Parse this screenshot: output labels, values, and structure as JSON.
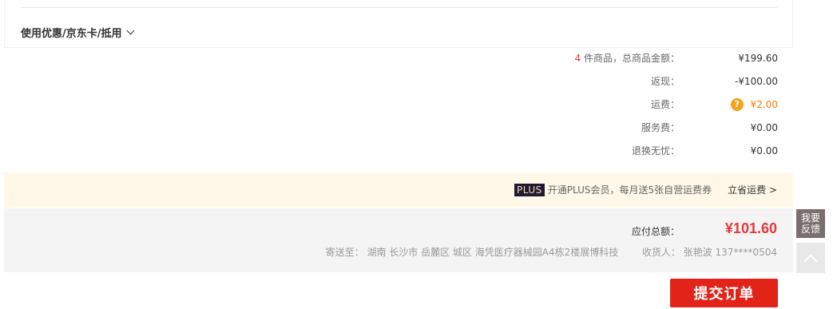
{
  "coupon": {
    "label": "使用优惠/京东卡/抵用"
  },
  "summary": {
    "count": "4",
    "items_label": " 件商品，总商品金额：",
    "items_value": "¥199.60",
    "cashback_label": "返现：",
    "cashback_value": "-¥100.00",
    "shipping_label": "运费：",
    "shipping_help": "?",
    "shipping_value": "¥2.00",
    "service_label": "服务费：",
    "service_value": "¥0.00",
    "return_label": "退换无忧：",
    "return_value": "¥0.00"
  },
  "plus": {
    "logo": "PLUS",
    "text": "开通PLUS会员，每月送5张自营运费券",
    "link": "立省运费 >"
  },
  "total": {
    "payable_label": "应付总额：",
    "payable_amount": "¥101.60",
    "ship_to_label": "寄送至：",
    "address": "湖南 长沙市 岳麓区 城区 海凭医疗器械园A4栋2楼展博科技",
    "receiver_label": "收货人：",
    "receiver": "张艳波 137****0504"
  },
  "actions": {
    "submit": "提交订单"
  },
  "side": {
    "feedback_line1": "我要",
    "feedback_line2": "反馈"
  },
  "colors": {
    "accent_red": "#e4393c",
    "button_red": "#e2231a",
    "shipping_orange": "#ff7a00",
    "plus_bg": "#fff8e9"
  }
}
